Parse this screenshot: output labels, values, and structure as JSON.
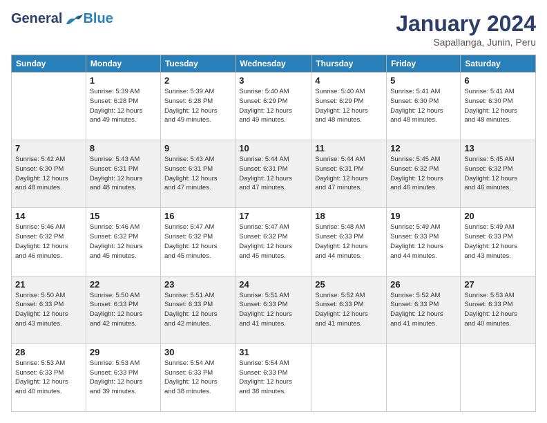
{
  "logo": {
    "general": "General",
    "blue": "Blue"
  },
  "header": {
    "month": "January 2024",
    "location": "Sapallanga, Junin, Peru"
  },
  "weekdays": [
    "Sunday",
    "Monday",
    "Tuesday",
    "Wednesday",
    "Thursday",
    "Friday",
    "Saturday"
  ],
  "weeks": [
    [
      {
        "day": "",
        "info": ""
      },
      {
        "day": "1",
        "info": "Sunrise: 5:39 AM\nSunset: 6:28 PM\nDaylight: 12 hours\nand 49 minutes."
      },
      {
        "day": "2",
        "info": "Sunrise: 5:39 AM\nSunset: 6:28 PM\nDaylight: 12 hours\nand 49 minutes."
      },
      {
        "day": "3",
        "info": "Sunrise: 5:40 AM\nSunset: 6:29 PM\nDaylight: 12 hours\nand 49 minutes."
      },
      {
        "day": "4",
        "info": "Sunrise: 5:40 AM\nSunset: 6:29 PM\nDaylight: 12 hours\nand 48 minutes."
      },
      {
        "day": "5",
        "info": "Sunrise: 5:41 AM\nSunset: 6:30 PM\nDaylight: 12 hours\nand 48 minutes."
      },
      {
        "day": "6",
        "info": "Sunrise: 5:41 AM\nSunset: 6:30 PM\nDaylight: 12 hours\nand 48 minutes."
      }
    ],
    [
      {
        "day": "7",
        "info": "Sunrise: 5:42 AM\nSunset: 6:30 PM\nDaylight: 12 hours\nand 48 minutes."
      },
      {
        "day": "8",
        "info": "Sunrise: 5:43 AM\nSunset: 6:31 PM\nDaylight: 12 hours\nand 48 minutes."
      },
      {
        "day": "9",
        "info": "Sunrise: 5:43 AM\nSunset: 6:31 PM\nDaylight: 12 hours\nand 47 minutes."
      },
      {
        "day": "10",
        "info": "Sunrise: 5:44 AM\nSunset: 6:31 PM\nDaylight: 12 hours\nand 47 minutes."
      },
      {
        "day": "11",
        "info": "Sunrise: 5:44 AM\nSunset: 6:31 PM\nDaylight: 12 hours\nand 47 minutes."
      },
      {
        "day": "12",
        "info": "Sunrise: 5:45 AM\nSunset: 6:32 PM\nDaylight: 12 hours\nand 46 minutes."
      },
      {
        "day": "13",
        "info": "Sunrise: 5:45 AM\nSunset: 6:32 PM\nDaylight: 12 hours\nand 46 minutes."
      }
    ],
    [
      {
        "day": "14",
        "info": "Sunrise: 5:46 AM\nSunset: 6:32 PM\nDaylight: 12 hours\nand 46 minutes."
      },
      {
        "day": "15",
        "info": "Sunrise: 5:46 AM\nSunset: 6:32 PM\nDaylight: 12 hours\nand 45 minutes."
      },
      {
        "day": "16",
        "info": "Sunrise: 5:47 AM\nSunset: 6:32 PM\nDaylight: 12 hours\nand 45 minutes."
      },
      {
        "day": "17",
        "info": "Sunrise: 5:47 AM\nSunset: 6:32 PM\nDaylight: 12 hours\nand 45 minutes."
      },
      {
        "day": "18",
        "info": "Sunrise: 5:48 AM\nSunset: 6:33 PM\nDaylight: 12 hours\nand 44 minutes."
      },
      {
        "day": "19",
        "info": "Sunrise: 5:49 AM\nSunset: 6:33 PM\nDaylight: 12 hours\nand 44 minutes."
      },
      {
        "day": "20",
        "info": "Sunrise: 5:49 AM\nSunset: 6:33 PM\nDaylight: 12 hours\nand 43 minutes."
      }
    ],
    [
      {
        "day": "21",
        "info": "Sunrise: 5:50 AM\nSunset: 6:33 PM\nDaylight: 12 hours\nand 43 minutes."
      },
      {
        "day": "22",
        "info": "Sunrise: 5:50 AM\nSunset: 6:33 PM\nDaylight: 12 hours\nand 42 minutes."
      },
      {
        "day": "23",
        "info": "Sunrise: 5:51 AM\nSunset: 6:33 PM\nDaylight: 12 hours\nand 42 minutes."
      },
      {
        "day": "24",
        "info": "Sunrise: 5:51 AM\nSunset: 6:33 PM\nDaylight: 12 hours\nand 41 minutes."
      },
      {
        "day": "25",
        "info": "Sunrise: 5:52 AM\nSunset: 6:33 PM\nDaylight: 12 hours\nand 41 minutes."
      },
      {
        "day": "26",
        "info": "Sunrise: 5:52 AM\nSunset: 6:33 PM\nDaylight: 12 hours\nand 41 minutes."
      },
      {
        "day": "27",
        "info": "Sunrise: 5:53 AM\nSunset: 6:33 PM\nDaylight: 12 hours\nand 40 minutes."
      }
    ],
    [
      {
        "day": "28",
        "info": "Sunrise: 5:53 AM\nSunset: 6:33 PM\nDaylight: 12 hours\nand 40 minutes."
      },
      {
        "day": "29",
        "info": "Sunrise: 5:53 AM\nSunset: 6:33 PM\nDaylight: 12 hours\nand 39 minutes."
      },
      {
        "day": "30",
        "info": "Sunrise: 5:54 AM\nSunset: 6:33 PM\nDaylight: 12 hours\nand 38 minutes."
      },
      {
        "day": "31",
        "info": "Sunrise: 5:54 AM\nSunset: 6:33 PM\nDaylight: 12 hours\nand 38 minutes."
      },
      {
        "day": "",
        "info": ""
      },
      {
        "day": "",
        "info": ""
      },
      {
        "day": "",
        "info": ""
      }
    ]
  ]
}
